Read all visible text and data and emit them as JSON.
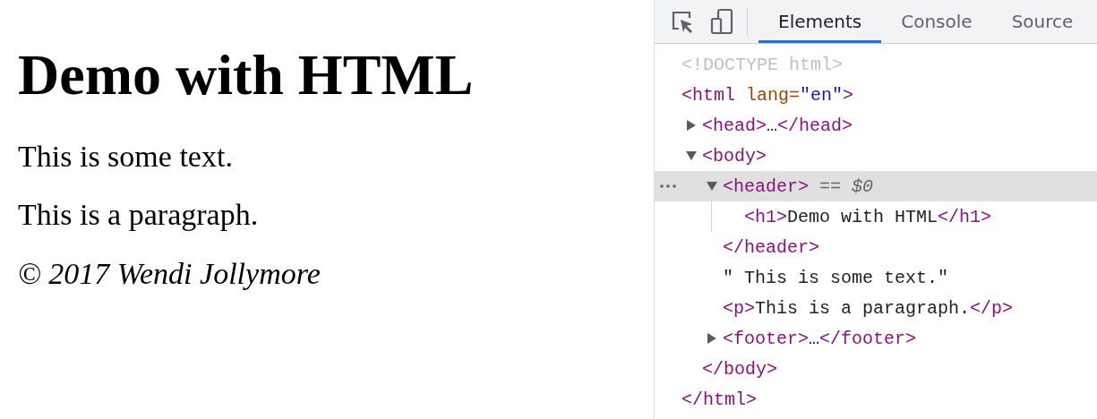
{
  "page": {
    "heading": "Demo with HTML",
    "blocks": [
      {
        "kind": "text",
        "text": "This is some text."
      },
      {
        "kind": "paragraph",
        "text": "This is a paragraph."
      },
      {
        "kind": "footer",
        "text": "© 2017 Wendi Jollymore"
      }
    ]
  },
  "devtools": {
    "tabs": [
      {
        "label": "Elements",
        "selected": true
      },
      {
        "label": "Console",
        "selected": false
      },
      {
        "label": "Source",
        "selected": false
      }
    ],
    "tree": [
      {
        "selected": false,
        "open": [
          {
            "kind": "doctype",
            "text": "<!DOCTYPE html>"
          }
        ]
      },
      {
        "selected": false,
        "open": [
          {
            "kind": "tag",
            "text": "<html "
          },
          {
            "kind": "attr",
            "text": "lang="
          },
          {
            "kind": "value",
            "text": "\"en\""
          },
          {
            "kind": "tag",
            "text": ">"
          }
        ],
        "close": [
          {
            "kind": "tag",
            "text": "</html>"
          }
        ],
        "children": [
          {
            "selected": false,
            "expanded": false,
            "open": [
              {
                "kind": "tag",
                "text": "<head>"
              },
              {
                "kind": "text",
                "text": "…"
              },
              {
                "kind": "tag",
                "text": "</head>"
              }
            ]
          },
          {
            "selected": false,
            "expanded": true,
            "open": [
              {
                "kind": "tag",
                "text": "<body>"
              }
            ],
            "close": [
              {
                "kind": "tag",
                "text": "</body>"
              }
            ],
            "children": [
              {
                "selected": true,
                "expanded": true,
                "open": [
                  {
                    "kind": "tag",
                    "text": "<header>"
                  },
                  {
                    "kind": "hint",
                    "text": " == $0"
                  }
                ],
                "close": [
                  {
                    "kind": "tag",
                    "text": "</header>"
                  }
                ],
                "children": [
                  {
                    "selected": false,
                    "open": [
                      {
                        "kind": "tag",
                        "text": "<h1>"
                      },
                      {
                        "kind": "text",
                        "text": "Demo with HTML"
                      },
                      {
                        "kind": "tag",
                        "text": "</h1>"
                      }
                    ]
                  }
                ]
              },
              {
                "selected": false,
                "open": [
                  {
                    "kind": "text",
                    "text": "\" This is some text.\""
                  }
                ]
              },
              {
                "selected": false,
                "open": [
                  {
                    "kind": "tag",
                    "text": "<p>"
                  },
                  {
                    "kind": "text",
                    "text": "This is a paragraph."
                  },
                  {
                    "kind": "tag",
                    "text": "</p>"
                  }
                ]
              },
              {
                "selected": false,
                "expanded": false,
                "open": [
                  {
                    "kind": "tag",
                    "text": "<footer>"
                  },
                  {
                    "kind": "text",
                    "text": "…"
                  },
                  {
                    "kind": "tag",
                    "text": "</footer>"
                  }
                ]
              }
            ]
          }
        ]
      }
    ]
  }
}
